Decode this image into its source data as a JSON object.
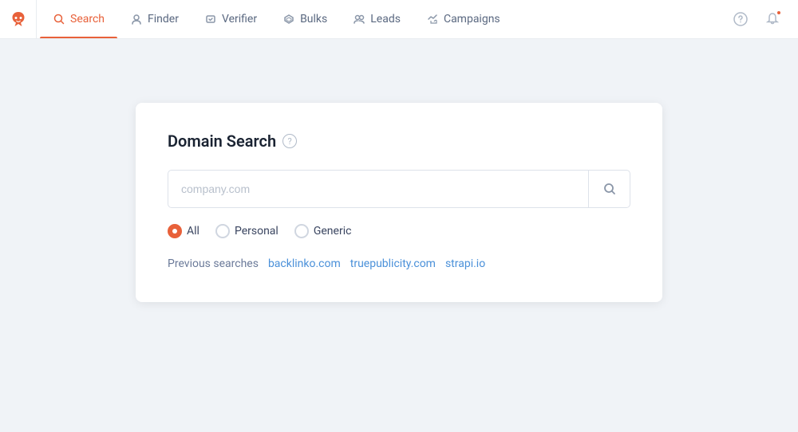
{
  "app": {
    "logo_alt": "Hunter logo"
  },
  "nav": {
    "items": [
      {
        "id": "search",
        "label": "Search",
        "active": true
      },
      {
        "id": "finder",
        "label": "Finder",
        "active": false
      },
      {
        "id": "verifier",
        "label": "Verifier",
        "active": false
      },
      {
        "id": "bulks",
        "label": "Bulks",
        "active": false
      },
      {
        "id": "leads",
        "label": "Leads",
        "active": false
      },
      {
        "id": "campaigns",
        "label": "Campaigns",
        "active": false
      }
    ],
    "help_label": "?",
    "notification_label": "🔔"
  },
  "card": {
    "title": "Domain Search",
    "search_placeholder": "company.com",
    "filters": [
      {
        "id": "all",
        "label": "All",
        "checked": true
      },
      {
        "id": "personal",
        "label": "Personal",
        "checked": false
      },
      {
        "id": "generic",
        "label": "Generic",
        "checked": false
      }
    ],
    "previous_searches_label": "Previous searches",
    "previous_searches": [
      {
        "id": "backlinko",
        "label": "backlinko.com"
      },
      {
        "id": "truepublicity",
        "label": "truepublicity.com"
      },
      {
        "id": "strapi",
        "label": "strapi.io"
      }
    ]
  }
}
